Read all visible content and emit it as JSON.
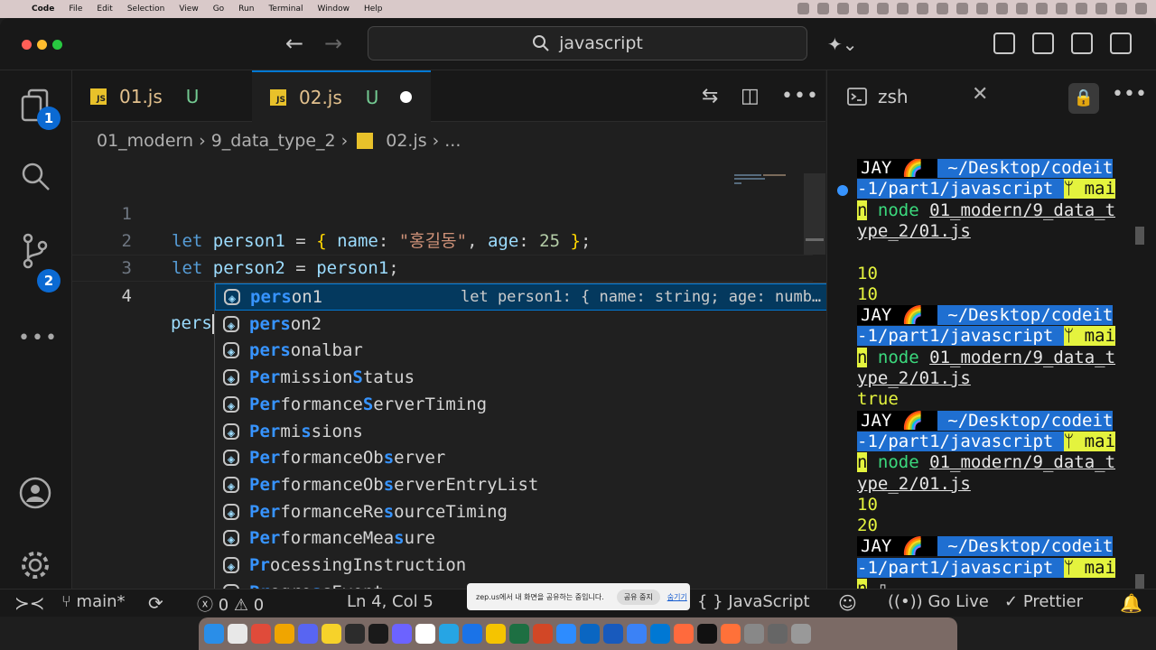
{
  "menubar": {
    "app": "Code",
    "items": [
      "File",
      "Edit",
      "Selection",
      "View",
      "Go",
      "Run",
      "Terminal",
      "Window",
      "Help"
    ]
  },
  "titlebar": {
    "search": "javascript"
  },
  "activity": {
    "explorer_badge": "1",
    "scm_badge": "2"
  },
  "tabs": [
    {
      "label": "01.js",
      "status": "U",
      "icon": "JS"
    },
    {
      "label": "02.js",
      "status": "U",
      "icon": "JS"
    }
  ],
  "breadcrumb": {
    "folder1": "01_modern",
    "folder2": "9_data_type_2",
    "file": "02.js",
    "tail": "..."
  },
  "code": {
    "line_numbers": [
      "1",
      "2",
      "3",
      "4"
    ],
    "l1": {
      "kw": "let",
      "var": "person1",
      "eq": " = ",
      "open": "{",
      "key1": " name",
      "colon1": ": ",
      "str": "\"홍길동\"",
      "comma": ", ",
      "key2": "age",
      "colon2": ": ",
      "num": "25",
      "close": " }",
      "semi": ";"
    },
    "l2": {
      "kw": "let",
      "var": "person2",
      "eq": " = ",
      "rhs": "person1",
      "semi": ";"
    },
    "l4": {
      "typed": "pers"
    }
  },
  "suggest": {
    "items": [
      {
        "hl1": "pers",
        "rest1": "on1",
        "hl2": "",
        "rest2": ""
      },
      {
        "hl1": "pers",
        "rest1": "on2",
        "hl2": "",
        "rest2": ""
      },
      {
        "hl1": "pers",
        "rest1": "onalbar",
        "hl2": "",
        "rest2": ""
      },
      {
        "hl1": "Per",
        "rest1": "mission",
        "hl2": "S",
        "rest2": "tatus"
      },
      {
        "hl1": "Per",
        "rest1": "formance",
        "hl2": "S",
        "rest2": "erverTiming"
      },
      {
        "hl1": "Per",
        "rest1": "mi",
        "hl2": "s",
        "rest2": "sions"
      },
      {
        "hl1": "Per",
        "rest1": "formanceOb",
        "hl2": "s",
        "rest2": "erver"
      },
      {
        "hl1": "Per",
        "rest1": "formanceOb",
        "hl2": "s",
        "rest2": "erverEntryList"
      },
      {
        "hl1": "Per",
        "rest1": "formanceRe",
        "hl2": "s",
        "rest2": "ourceTiming"
      },
      {
        "hl1": "Per",
        "rest1": "formanceMea",
        "hl2": "s",
        "rest2": "ure"
      },
      {
        "hl1": "Pr",
        "rest1": "ocessingInstruction",
        "hl2": "",
        "rest2": ""
      },
      {
        "hl1": "Pr",
        "rest1": "ogre",
        "hl2": "s",
        "rest2": "sEvent"
      }
    ],
    "detail": "let person1: { name: string; age: numb…"
  },
  "terminal": {
    "tab": "zsh",
    "prompt_user": "JAY 🌈 ",
    "prompt_dir": " ~/Desktop/codeit",
    "dir_cont": "-1/part1/javascript ",
    "branch": "ᛘ mai",
    "cmd_word": "node",
    "cmd_path1": "01_modern/9_data_t",
    "cmd_path2": "ype_2/01.js",
    "out1": "10",
    "out2": "10",
    "out3": "true",
    "out4": "10",
    "out5": "20"
  },
  "statusbar": {
    "branch": "main*",
    "errors": "0",
    "warnings": "0",
    "position": "Ln 4, Col 5",
    "language": "JavaScript",
    "golive": "Go Live",
    "prettier": "Prettier"
  },
  "share": {
    "message": "zep.us에서 내 화면을 공유하는 중입니다.",
    "stop": "공유 중지",
    "hide": "숨기기"
  },
  "colors": {
    "accent": "#0078d4",
    "badge": "#0b6ad3",
    "js_icon": "#e8c12a",
    "prompt_blue": "#1f6fd1",
    "prompt_yellow": "#e4f33e"
  }
}
